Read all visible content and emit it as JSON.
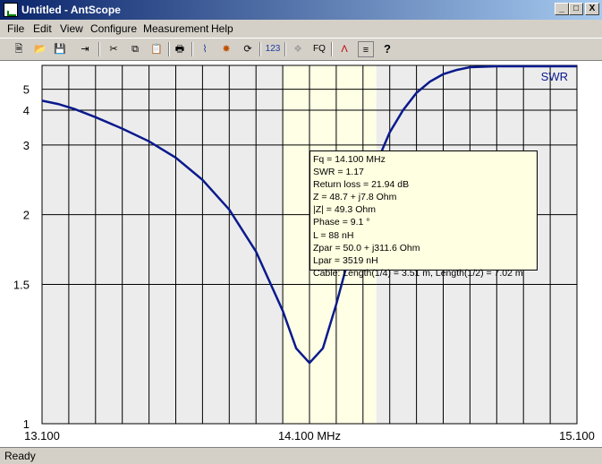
{
  "window": {
    "title": "Untitled - AntScope",
    "minimize": "_",
    "maximize": "□",
    "close": "X"
  },
  "menu": [
    "File",
    "Edit",
    "View",
    "Configure",
    "Measurement",
    "Help"
  ],
  "toolbar": {
    "icons": [
      "new-icon",
      "open-icon",
      "save-icon",
      "export-icon",
      "cut-icon",
      "copy-icon",
      "paste-icon",
      "print-icon",
      "graph-icon",
      "star-icon",
      "refresh-icon",
      "numbers-icon",
      "antenna-icon",
      "fq-icon",
      "marker-icon",
      "settings-icon",
      "help-icon"
    ],
    "numbers_label": "123",
    "fq_label": "FQ",
    "help_label": "?"
  },
  "colors": {
    "plot_bg": "#ececec",
    "band": "#ffffe6",
    "curve": "#0a1a8c",
    "grid": "#000000"
  },
  "tooltip": [
    "Fq = 14.100 MHz",
    "SWR = 1.17",
    "Return loss = 21.94 dB",
    "Z = 48.7 + j7.8 Ohm",
    "|Z| = 49.3 Ohm",
    "Phase = 9.1 °",
    "L = 88 nH",
    "Zpar = 50.0 + j311.6 Ohm",
    "Lpar = 3519 nH",
    "Cable: Length(1/4) = 3.51 m, Length(1/2) = 7.02 m"
  ],
  "status": {
    "text": "Ready"
  },
  "chart_data": {
    "type": "line",
    "series": [
      {
        "name": "SWR",
        "x": [
          13.1,
          13.16,
          13.22,
          13.3,
          13.4,
          13.5,
          13.6,
          13.7,
          13.8,
          13.9,
          14.0,
          14.05,
          14.1,
          14.15,
          14.2,
          14.25,
          14.3,
          14.35,
          14.4,
          14.45,
          14.5,
          14.55,
          14.6,
          14.65,
          14.7,
          14.8,
          14.9,
          15.0,
          15.1
        ],
        "y": [
          4.4,
          4.25,
          4.05,
          3.75,
          3.4,
          3.08,
          2.75,
          2.4,
          2.05,
          1.7,
          1.37,
          1.22,
          1.17,
          1.22,
          1.4,
          1.68,
          2.1,
          2.65,
          3.3,
          4.0,
          4.8,
          5.5,
          6.1,
          6.5,
          6.8,
          6.9,
          6.9,
          6.9,
          6.9
        ]
      }
    ],
    "xlim": [
      13.1,
      15.1
    ],
    "ylim": [
      1,
      7
    ],
    "x_ticks": [
      {
        "value": 13.1,
        "label": "13.100"
      },
      {
        "value": 14.1,
        "label": "14.100 MHz"
      },
      {
        "value": 15.1,
        "label": "15.100"
      }
    ],
    "y_ticks": [
      {
        "value": 1,
        "label": "1"
      },
      {
        "value": 1.5,
        "label": "1.5"
      },
      {
        "value": 2,
        "label": "2"
      },
      {
        "value": 3,
        "label": "3"
      },
      {
        "value": 4,
        "label": "4"
      },
      {
        "value": 5,
        "label": "5"
      }
    ],
    "band": [
      14.0,
      14.35
    ],
    "grid": true,
    "legend_position": "top-right"
  }
}
